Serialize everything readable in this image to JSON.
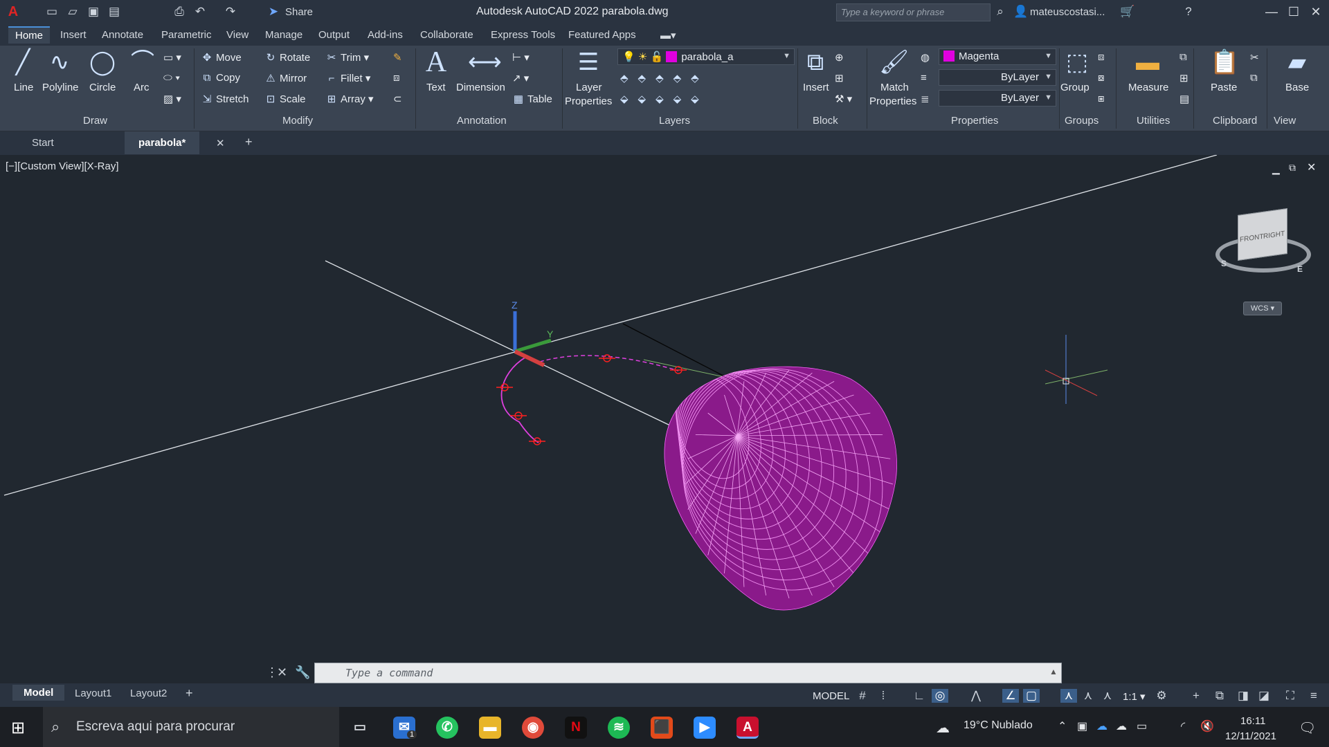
{
  "titlebar": {
    "title": "Autodesk AutoCAD 2022   parabola.dwg",
    "share_label": "Share",
    "search_placeholder": "Type a keyword or phrase",
    "user": "mateuscostasi...",
    "app_letter": "A"
  },
  "menu": {
    "tabs": [
      "Home",
      "Insert",
      "Annotate",
      "Parametric",
      "View",
      "Manage",
      "Output",
      "Add-ins",
      "Collaborate",
      "Express Tools",
      "Featured Apps"
    ],
    "active": "Home"
  },
  "ribbon": {
    "draw": {
      "line": "Line",
      "polyline": "Polyline",
      "circle": "Circle",
      "arc": "Arc",
      "title": "Draw"
    },
    "modify": {
      "move": "Move",
      "rotate": "Rotate",
      "trim": "Trim",
      "copy": "Copy",
      "mirror": "Mirror",
      "fillet": "Fillet",
      "stretch": "Stretch",
      "scale": "Scale",
      "array": "Array",
      "title": "Modify"
    },
    "annotation": {
      "text": "Text",
      "dimension": "Dimension",
      "table": "Table",
      "title": "Annotation"
    },
    "layers": {
      "layer_properties_1": "Layer",
      "layer_properties_2": "Properties",
      "current_layer": "parabola_a",
      "title": "Layers"
    },
    "block": {
      "insert": "Insert",
      "title": "Block"
    },
    "properties": {
      "match_1": "Match",
      "match_2": "Properties",
      "color": "Magenta",
      "linetype": "ByLayer",
      "lineweight": "ByLayer",
      "title": "Properties"
    },
    "groups": {
      "group": "Group",
      "title": "Groups"
    },
    "utilities": {
      "measure": "Measure",
      "title": "Utilities"
    },
    "clipboard": {
      "paste": "Paste",
      "title": "Clipboard"
    },
    "view": {
      "base": "Base",
      "title": "View"
    }
  },
  "doctabs": {
    "start": "Start",
    "active": "parabola*"
  },
  "viewport": {
    "label": "[−][Custom View][X-Ray]",
    "viewcube_front": "FRONT",
    "viewcube_right": "RIGHT",
    "wcs": "WCS",
    "compass_s": "S",
    "compass_e": "E",
    "axis_z": "Z",
    "axis_y": "Y"
  },
  "command": {
    "placeholder": "Type a command"
  },
  "status": {
    "layouts": [
      "Model",
      "Layout1",
      "Layout2"
    ],
    "model": "MODEL",
    "scale": "1:1"
  },
  "taskbar": {
    "search": "Escreva aqui para procurar",
    "weather": "19°C  Nublado",
    "time": "16:11",
    "date": "12/11/2021",
    "mail_badge": "1"
  },
  "colors": {
    "accent": "#4a90d9",
    "magenta": "#e000e0",
    "viewport_bg": "#212830"
  }
}
